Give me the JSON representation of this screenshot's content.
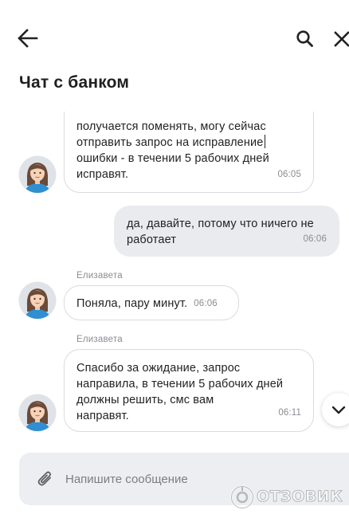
{
  "header": {
    "title": "Чат с банком"
  },
  "messages": [
    {
      "direction": "incoming",
      "text": "получается поменять, могу сейчас\nотправить запрос на исправление",
      "text_after_cursor": "\nошибки - в течении 5 рабочих  дней\nисправят.",
      "time": "06:05"
    },
    {
      "direction": "outgoing",
      "text": "да, давайте, потому что ничего не\nработает",
      "time": "06:06"
    },
    {
      "direction": "incoming",
      "sender": "Елизавета",
      "text": "Поняла, пару минут.",
      "time": "06:06"
    },
    {
      "direction": "incoming",
      "sender": "Елизавета",
      "text": "Спасибо за ожидание, запрос\nнаправила, в течении 5 рабочих дней\nдолжны решить, смс вам\nнаправят.",
      "time": "06:11"
    }
  ],
  "composer": {
    "placeholder": "Напишите сообщение"
  },
  "watermark": {
    "text": "ОТЗОВИК"
  },
  "icons": {
    "back": "arrow-left-icon",
    "search": "search-icon",
    "close": "close-icon",
    "scroll": "chevron-down-icon",
    "attach": "paperclip-icon"
  },
  "colors": {
    "outgoing_bubble": "#e9ebee",
    "incoming_border": "#d9dbe0",
    "composer_bg": "#eceef1",
    "meta_text": "#8a8d93"
  }
}
